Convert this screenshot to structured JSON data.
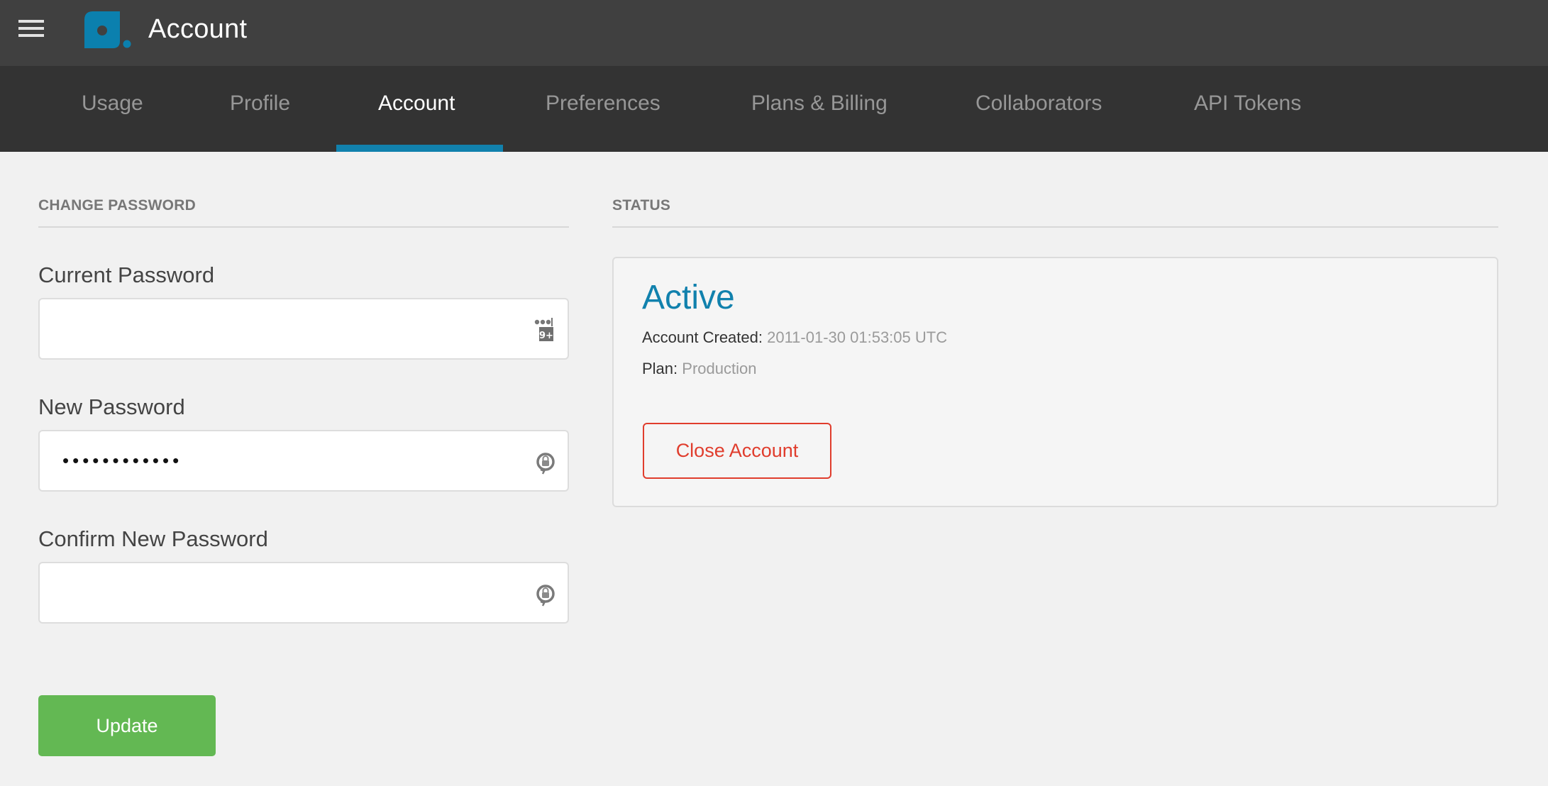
{
  "header": {
    "title": "Account",
    "menu_icon": "hamburger-menu-icon",
    "logo_icon": "app-logo",
    "brand_color": "#1181ad"
  },
  "tabs": [
    {
      "label": "Usage",
      "active": false
    },
    {
      "label": "Profile",
      "active": false
    },
    {
      "label": "Account",
      "active": true
    },
    {
      "label": "Preferences",
      "active": false
    },
    {
      "label": "Plans & Billing",
      "active": false
    },
    {
      "label": "Collaborators",
      "active": false
    },
    {
      "label": "API Tokens",
      "active": false
    }
  ],
  "change_password": {
    "section_title": "CHANGE PASSWORD",
    "fields": [
      {
        "label": "Current Password",
        "value": "",
        "masked_length": 0,
        "icon": "password-manager-icon"
      },
      {
        "label": "New Password",
        "value": "••••••••••••",
        "masked_length": 12,
        "icon": "password-generator-icon"
      },
      {
        "label": "Confirm New Password",
        "value": "",
        "masked_length": 0,
        "icon": "password-generator-icon"
      }
    ],
    "update_label": "Update",
    "update_color": "#63b853"
  },
  "status": {
    "section_title": "STATUS",
    "state": "Active",
    "created_label": "Account Created:",
    "created_value": "2011-01-30 01:53:05 UTC",
    "plan_label": "Plan:",
    "plan_value": "Production",
    "close_label": "Close Account",
    "close_color": "#e03d2d"
  }
}
